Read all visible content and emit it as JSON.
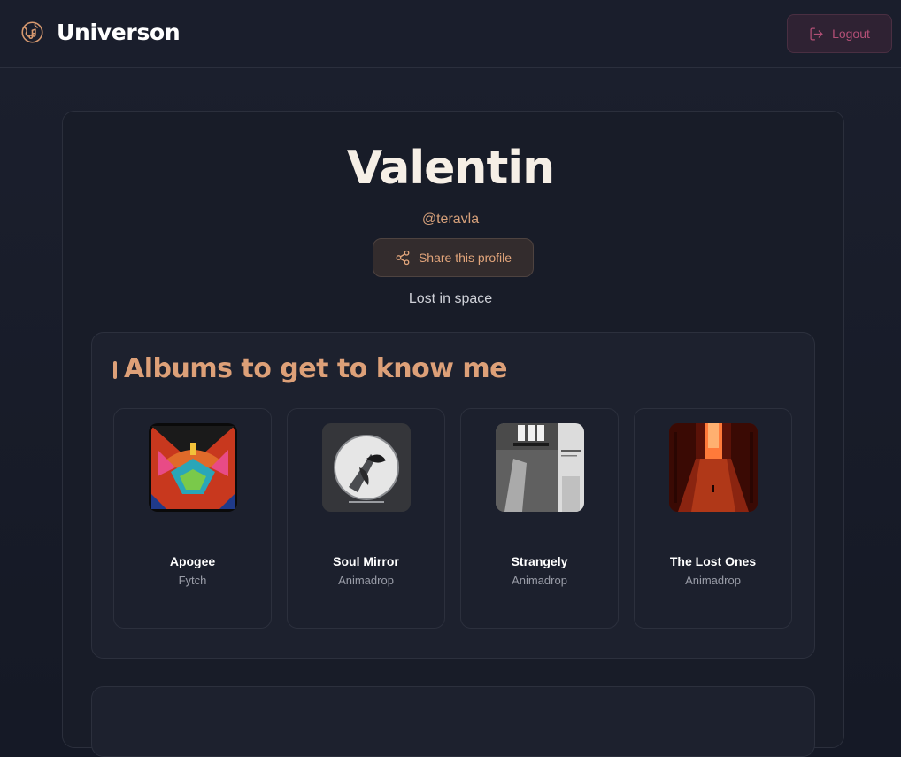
{
  "header": {
    "brand": "Universon",
    "brand_icon": "music-globe-icon",
    "logout_label": "Logout",
    "logout_icon": "logout-icon"
  },
  "profile": {
    "name": "Valentin",
    "handle": "@teravla",
    "share_label": "Share this profile",
    "share_icon": "share-icon",
    "bio": "Lost in space"
  },
  "albums_section": {
    "title": "Albums to get to know me",
    "albums": [
      {
        "title": "Apogee",
        "artist": "Fytch"
      },
      {
        "title": "Soul Mirror",
        "artist": "Animadrop"
      },
      {
        "title": "Strangely",
        "artist": "Animadrop"
      },
      {
        "title": "The Lost Ones",
        "artist": "Animadrop"
      }
    ]
  },
  "colors": {
    "accent": "#dda078",
    "background": "#151926",
    "logout": "#b34f76"
  }
}
